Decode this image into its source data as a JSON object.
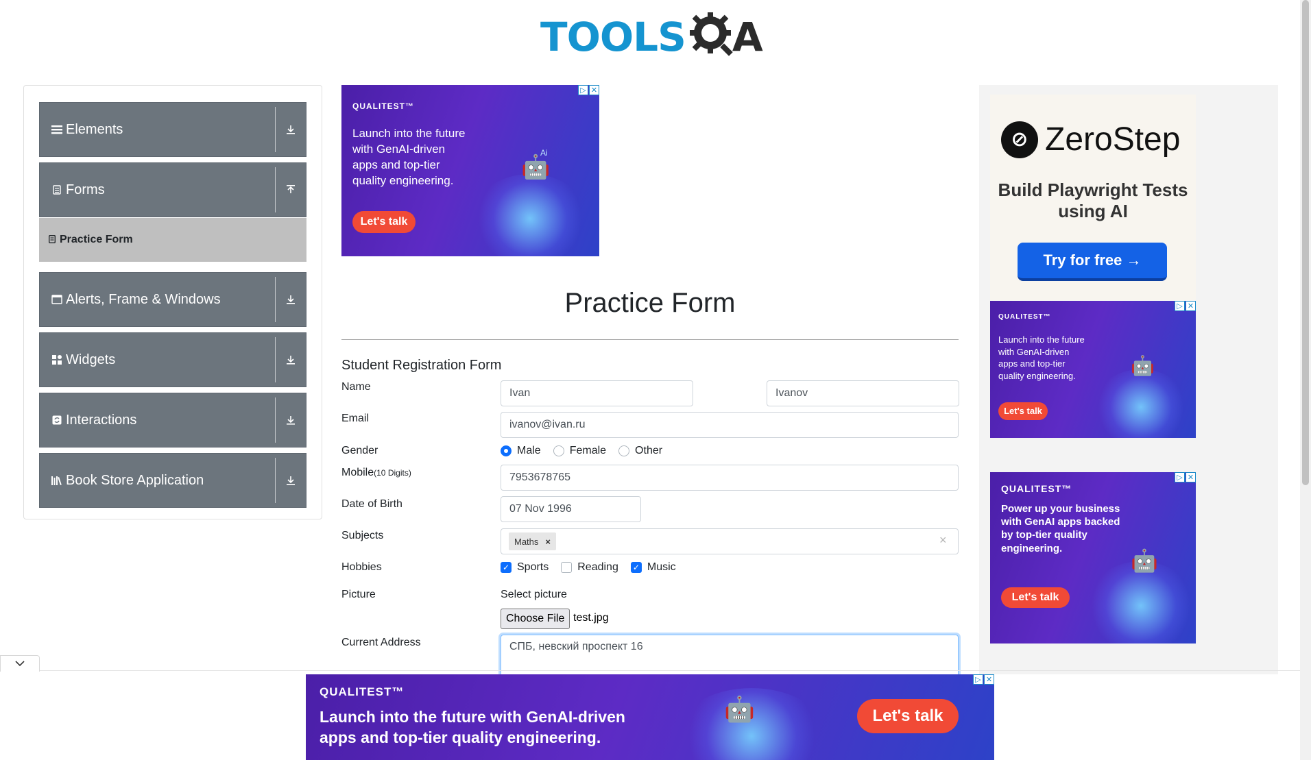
{
  "logo": {
    "part1": "TOOLS",
    "part2": "A"
  },
  "sidebar": {
    "groups": [
      {
        "label": "Elements",
        "icon": "menu-icon",
        "arrow": "download-icon"
      },
      {
        "label": "Forms",
        "icon": "document-icon",
        "arrow": "upload-icon"
      },
      {
        "label": "Alerts, Frame & Windows",
        "icon": "window-icon",
        "arrow": "download-icon"
      },
      {
        "label": "Widgets",
        "icon": "grid-icon",
        "arrow": "download-icon"
      },
      {
        "label": "Interactions",
        "icon": "sync-icon",
        "arrow": "download-icon"
      },
      {
        "label": "Book Store Application",
        "icon": "books-icon",
        "arrow": "download-icon"
      }
    ],
    "active_subitem": "Practice Form"
  },
  "ads": {
    "top": {
      "brand": "QUALITEST™",
      "text": "Launch into the future with GenAI-driven apps and top-tier quality engineering.",
      "button": "Let's talk"
    },
    "right1": {
      "brand": "QUALITEST™",
      "text": "Launch into the future with GenAI-driven apps and top-tier quality engineering.",
      "button": "Let's talk"
    },
    "right2": {
      "brand": "QUALITEST™",
      "text": "Power up your business with GenAI apps backed by top-tier quality engineering.",
      "button": "Let's talk"
    },
    "bottom": {
      "brand": "QUALITEST™",
      "text": "Launch into the future with GenAI-driven apps and top-tier quality engineering.",
      "button": "Let's talk"
    },
    "ai_label": "Ai"
  },
  "zerostep": {
    "name": "ZeroStep",
    "subtitle": "Build Playwright Tests using AI",
    "button": "Try for free →"
  },
  "form": {
    "page_title": "Practice Form",
    "title": "Student Registration Form",
    "labels": {
      "name": "Name",
      "email": "Email",
      "gender": "Gender",
      "mobile": "Mobile",
      "mobile_hint": "(10 Digits)",
      "dob": "Date of Birth",
      "subjects": "Subjects",
      "hobbies": "Hobbies",
      "picture": "Picture",
      "address": "Current Address"
    },
    "first_name": "Ivan",
    "last_name": "Ivanov",
    "email": "ivanov@ivan.ru",
    "gender_options": [
      "Male",
      "Female",
      "Other"
    ],
    "gender_selected": "Male",
    "mobile": "7953678765",
    "dob": "07 Nov 1996",
    "subjects": [
      "Maths"
    ],
    "hobbies": [
      {
        "label": "Sports",
        "checked": true
      },
      {
        "label": "Reading",
        "checked": false
      },
      {
        "label": "Music",
        "checked": true
      }
    ],
    "picture_prompt": "Select picture",
    "choose_file": "Choose File",
    "file_name": "test.jpg",
    "address": "СПБ, невский проспект 16"
  }
}
